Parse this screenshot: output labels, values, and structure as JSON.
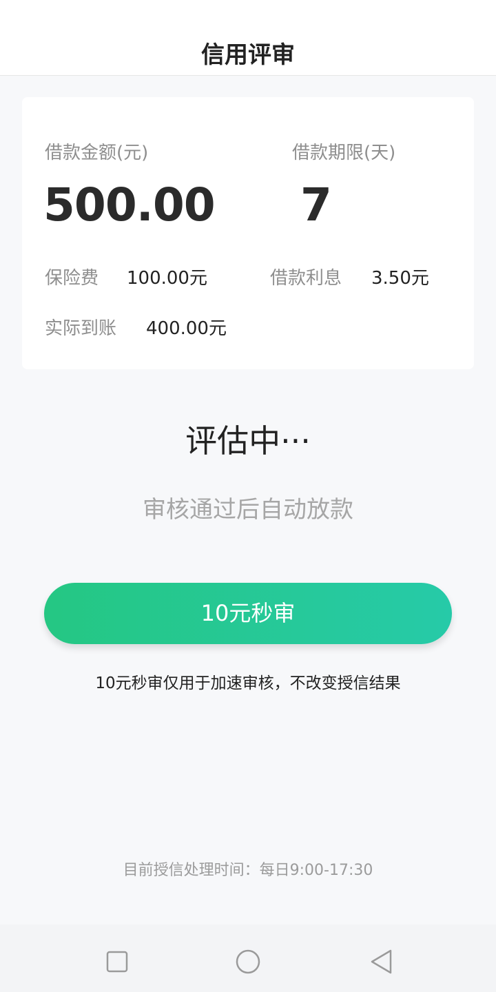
{
  "header": {
    "title": "信用评审"
  },
  "loan": {
    "amount_label": "借款金额(元)",
    "amount_value": "500.00",
    "term_label": "借款期限(天)",
    "term_value": "7",
    "insurance_label": "保险费",
    "insurance_value": "100.00元",
    "interest_label": "借款利息",
    "interest_value": "3.50元",
    "received_label": "实际到账",
    "received_value": "400.00元"
  },
  "status": {
    "title": "评估中···",
    "subtitle": "审核通过后自动放款"
  },
  "action": {
    "button_label": "10元秒审",
    "note": "10元秒审仅用于加速审核，不改变授信结果"
  },
  "footer": {
    "hours": "目前授信处理时间：每日9:00-17:30"
  },
  "colors": {
    "accent_start": "#25c783",
    "accent_end": "#26caa8",
    "status_indicator": "#2de0a0"
  },
  "nav_icons": [
    "recent-apps-icon",
    "home-icon",
    "back-icon"
  ]
}
